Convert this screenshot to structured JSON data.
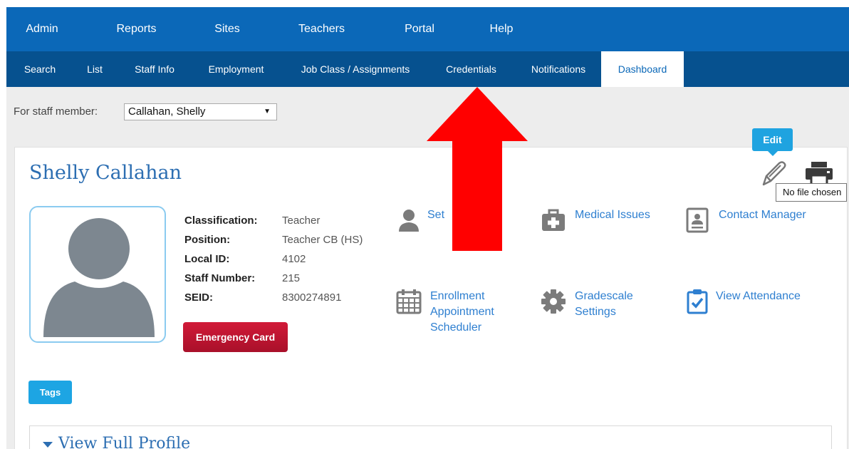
{
  "topnav": [
    "Admin",
    "Reports",
    "Sites",
    "Teachers",
    "Portal",
    "Help"
  ],
  "subnav": [
    "Search",
    "List",
    "Staff Info",
    "Employment",
    "Job Class / Assignments",
    "Credentials",
    "Notifications",
    "Dashboard"
  ],
  "subnav_active": "Dashboard",
  "staff": {
    "label": "For staff member:",
    "selected": "Callahan, Shelly"
  },
  "profile_card": {
    "name": "Shelly Callahan",
    "edit_label": "Edit",
    "fields": [
      {
        "key": "Classification:",
        "value": "Teacher"
      },
      {
        "key": "Position:",
        "value": "Teacher CB (HS)"
      },
      {
        "key": "Local ID:",
        "value": "4102"
      },
      {
        "key": "Staff Number:",
        "value": "215"
      },
      {
        "key": "SEID:",
        "value": "8300274891"
      }
    ],
    "emergency_button": "Emergency Card",
    "tags_button": "Tags",
    "view_full_profile": "View Full Profile"
  },
  "tools": {
    "set": "Set",
    "medical": "Medical Issues",
    "contact": "Contact Manager",
    "enrollment": "Enrollment\nAppointment\nScheduler",
    "gradescale": "Gradescale\nSettings",
    "attendance": "View Attendance"
  },
  "file_tooltip": "No file chosen",
  "colors": {
    "nav": "#0b68b8",
    "subnav": "#06518f",
    "link": "#2e7fd0",
    "emergency": "#c8142f",
    "tags": "#1da5e3",
    "arrow": "#ff0000"
  },
  "icons": [
    "user-icon",
    "medical-kit-icon",
    "contact-card-icon",
    "calendar-icon",
    "gear-icon",
    "clipboard-check-icon",
    "pencil-icon",
    "printer-icon",
    "arrow-up-icon"
  ]
}
